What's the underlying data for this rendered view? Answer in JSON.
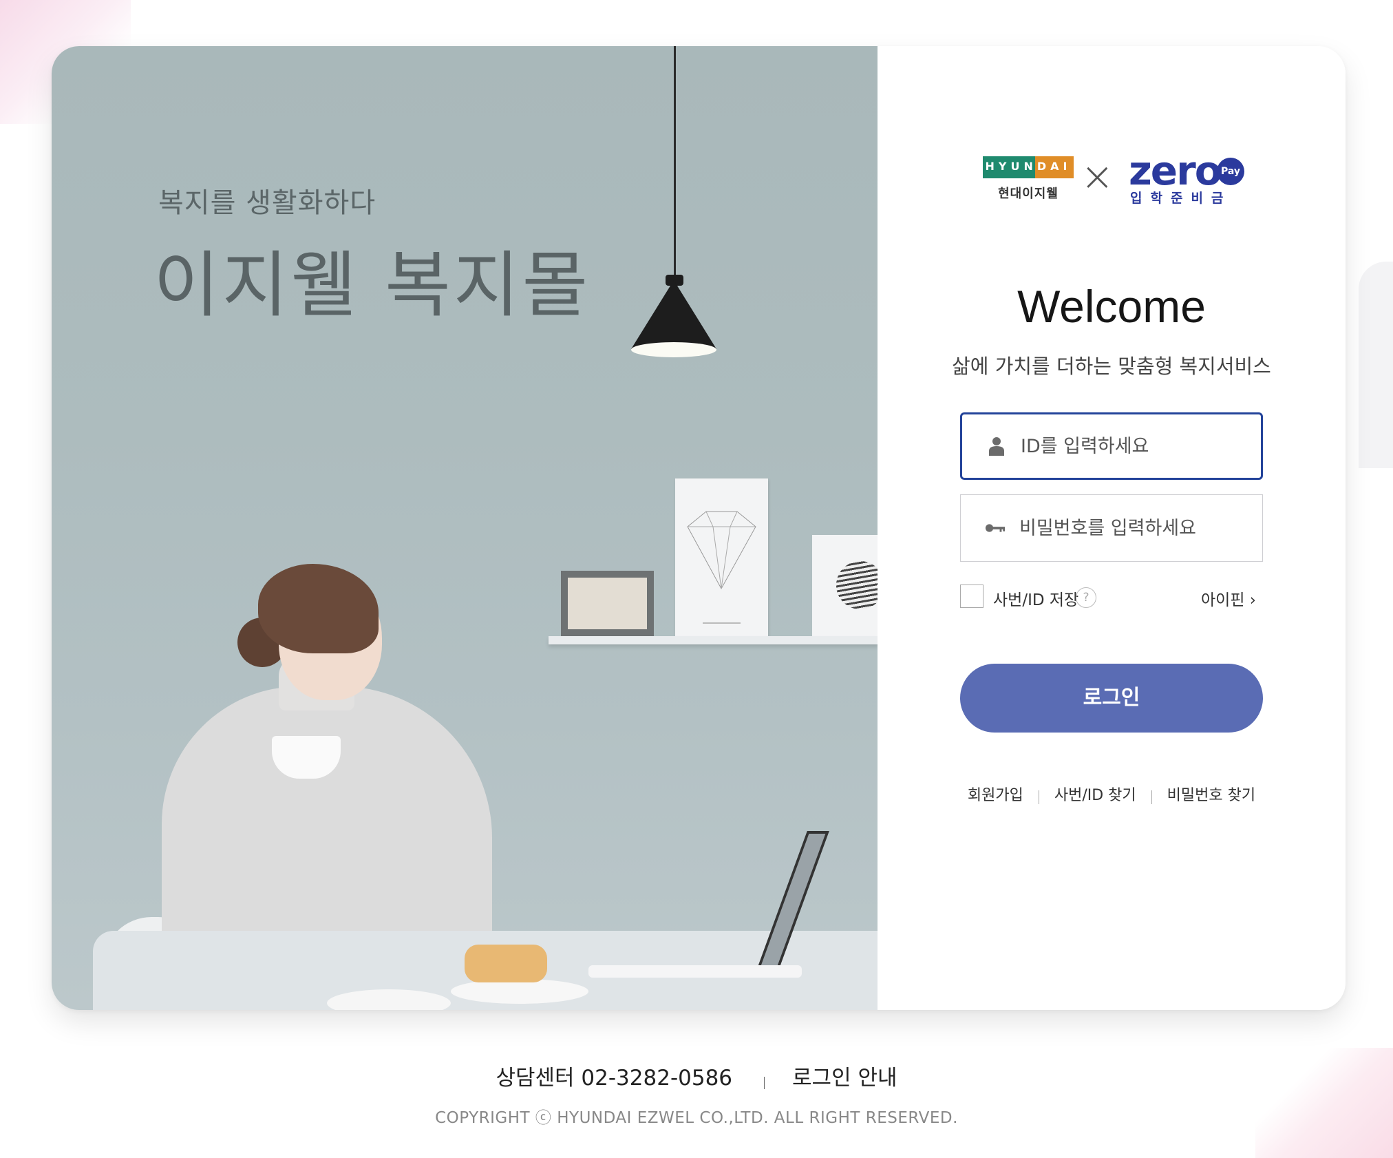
{
  "hero": {
    "tagline": "복지를 생활화하다",
    "title": "이지웰 복지몰"
  },
  "logos": {
    "hyundai_text": "HYUNDAI",
    "hyundai_sub": "현대이지웰",
    "times": "×",
    "zero_word": "zero",
    "zero_pay": "Pay",
    "zero_sub": "입학준비금"
  },
  "login": {
    "welcome": "Welcome",
    "subtitle": "삶에 가치를 더하는 맞춤형 복지서비스",
    "id_placeholder": "ID를 입력하세요",
    "id_value": "",
    "pw_placeholder": "비밀번호를 입력하세요",
    "pw_value": "",
    "save_label": "사번/ID 저장",
    "help_glyph": "?",
    "ipin_label": "아이핀 ›",
    "login_button": "로그인",
    "links": [
      "회원가입",
      "사번/ID 찾기",
      "비밀번호 찾기"
    ]
  },
  "footer": {
    "contact": "상담센터 02-3282-0586",
    "guide": "로그인 안내",
    "copyright": "COPYRIGHT ⓒ HYUNDAI EZWEL CO.,LTD. ALL RIGHT RESERVED."
  },
  "icons": {
    "id_field": "user-icon",
    "pw_field": "key-icon"
  },
  "colors": {
    "accent": "#5a6cb4",
    "active_border": "#23439a",
    "hyundai_green": "#1f8a6e",
    "hyundai_orange": "#e08d27",
    "zero_blue": "#2b3a9d"
  }
}
